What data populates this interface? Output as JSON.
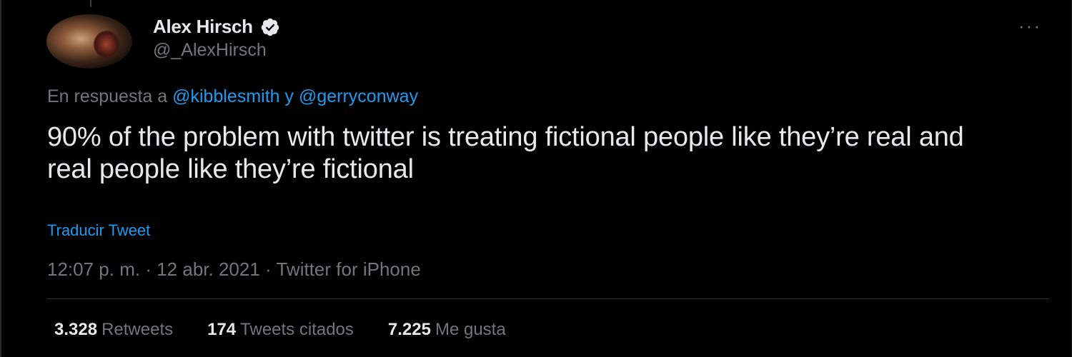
{
  "author": {
    "display_name": "Alex Hirsch",
    "handle": "@_AlexHirsch",
    "verified": true,
    "verified_icon": "verified-badge-icon",
    "avatar": "avatar-photo"
  },
  "more_label": "···",
  "reply": {
    "prefix": "En respuesta a",
    "mention_1": "@kibblesmith",
    "joiner": "y",
    "mention_2": "@gerryconway"
  },
  "tweet": {
    "text": "90% of the problem with twitter is treating fictional people like they’re real and real people like they’re fictional",
    "translate_label": "Traducir Tweet",
    "time": "12:07 p. m.",
    "separator": "·",
    "date": "12 abr. 2021",
    "source": "Twitter for iPhone"
  },
  "stats": [
    {
      "count": "3.328",
      "label": "Retweets"
    },
    {
      "count": "174",
      "label": "Tweets citados"
    },
    {
      "count": "7.225",
      "label": "Me gusta"
    }
  ],
  "colors": {
    "background": "#000000",
    "text": "#e7e9ea",
    "muted": "#71767b",
    "link": "#1d9bf0"
  }
}
